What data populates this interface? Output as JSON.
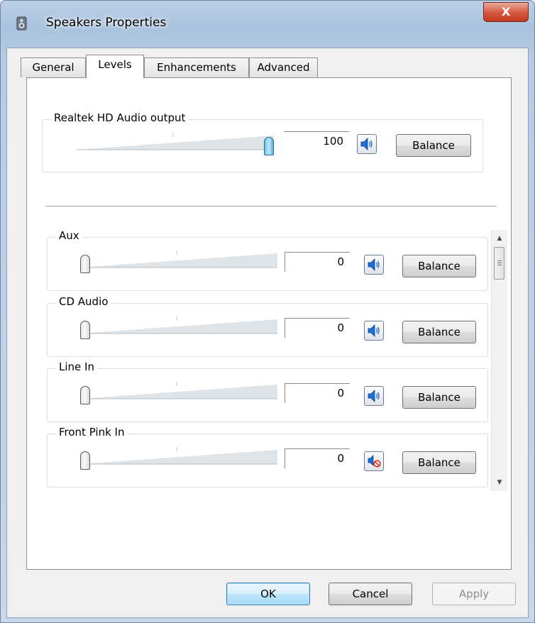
{
  "window": {
    "title": "Speakers Properties",
    "close_label": "X"
  },
  "tabs": [
    {
      "label": "General"
    },
    {
      "label": "Levels"
    },
    {
      "label": "Enhancements"
    },
    {
      "label": "Advanced"
    }
  ],
  "active_tab": "Levels",
  "master": {
    "label": "Realtek HD Audio output",
    "value": "100",
    "level": 1.0,
    "muted": false,
    "balance_label": "Balance"
  },
  "channels": [
    {
      "label": "Aux",
      "value": "0",
      "level": 0,
      "muted": false,
      "balance_label": "Balance"
    },
    {
      "label": "CD Audio",
      "value": "0",
      "level": 0,
      "muted": false,
      "balance_label": "Balance"
    },
    {
      "label": "Line In",
      "value": "0",
      "level": 0,
      "muted": false,
      "balance_label": "Balance"
    },
    {
      "label": "Front Pink In",
      "value": "0",
      "level": 0,
      "muted": true,
      "balance_label": "Balance"
    }
  ],
  "footer": {
    "ok_label": "OK",
    "cancel_label": "Cancel",
    "apply_label": "Apply"
  },
  "icons": {
    "title": "speaker-properties-icon",
    "speaker": "speaker-icon",
    "muted_speaker": "speaker-muted-icon"
  },
  "colors": {
    "accent_blue": "#1e6fd3",
    "mute_red": "#e0291d",
    "thumb_active": "#6fc1ec"
  }
}
